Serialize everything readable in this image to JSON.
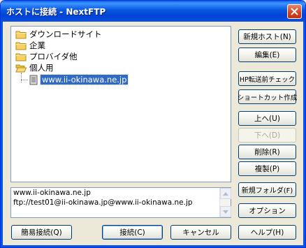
{
  "window": {
    "title": "ホストに接続 - NextFTP"
  },
  "tree": {
    "folders": [
      {
        "label": "ダウンロードサイト",
        "icon": "folder-closed"
      },
      {
        "label": "企業",
        "icon": "folder-closed"
      },
      {
        "label": "プロバイダ他",
        "icon": "folder-closed"
      },
      {
        "label": "個人用",
        "icon": "folder-open"
      }
    ],
    "child": {
      "label": "www.ii-okinawa.ne.jp",
      "icon": "host-server",
      "selected": true
    }
  },
  "info": {
    "line1": "www.ii-okinawa.ne.jp",
    "line2": "ftp://test01@ii-okinawa.jp@www.ii-okinawa.ne.jp"
  },
  "side_buttons": {
    "new_host": "新規ホスト(N)",
    "edit": "編集(E)",
    "hp_check": "HP転送前チェック",
    "shortcut": "ショートカット作成",
    "up": "上へ(U)",
    "down": "下へ(D)",
    "delete": "削除(R)",
    "copy": "複製(P)",
    "new_folder": "新規フォルダ(F)",
    "options": "オプション"
  },
  "bottom_buttons": {
    "quick_connect": "簡易接続(Q)",
    "connect": "接続(C)",
    "cancel": "キャンセル",
    "help": "ヘルプ(H)"
  },
  "colors": {
    "titlebar": "#0757e0",
    "selection": "#316ac5",
    "folder": "#f5d163"
  }
}
